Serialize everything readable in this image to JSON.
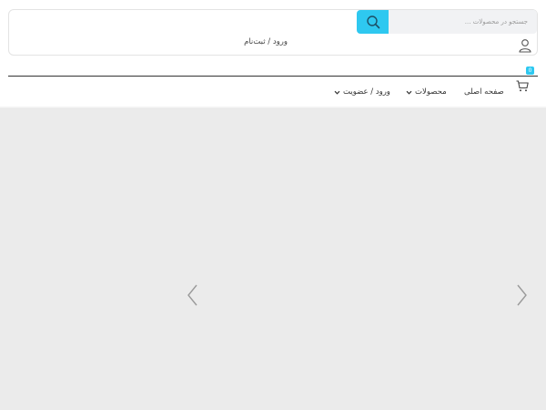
{
  "search": {
    "placeholder": "جستجو در محصولات ...",
    "icon": "search-icon",
    "button_color": "#2ec8f0"
  },
  "account": {
    "icon": "user-icon",
    "login_label": "ورود / ثبت‌نام"
  },
  "cart": {
    "icon": "cart-icon",
    "count": "0",
    "badge_color": "#2ec8f0"
  },
  "nav": {
    "items": [
      {
        "label": "صفحه اصلی",
        "has_dropdown": false
      },
      {
        "label": "محصولات",
        "has_dropdown": true
      },
      {
        "label": "ورود / عضویت",
        "has_dropdown": true
      }
    ]
  },
  "slider": {
    "prev_icon": "chevron-left-icon",
    "next_icon": "chevron-right-icon",
    "background": "#ebebeb"
  }
}
